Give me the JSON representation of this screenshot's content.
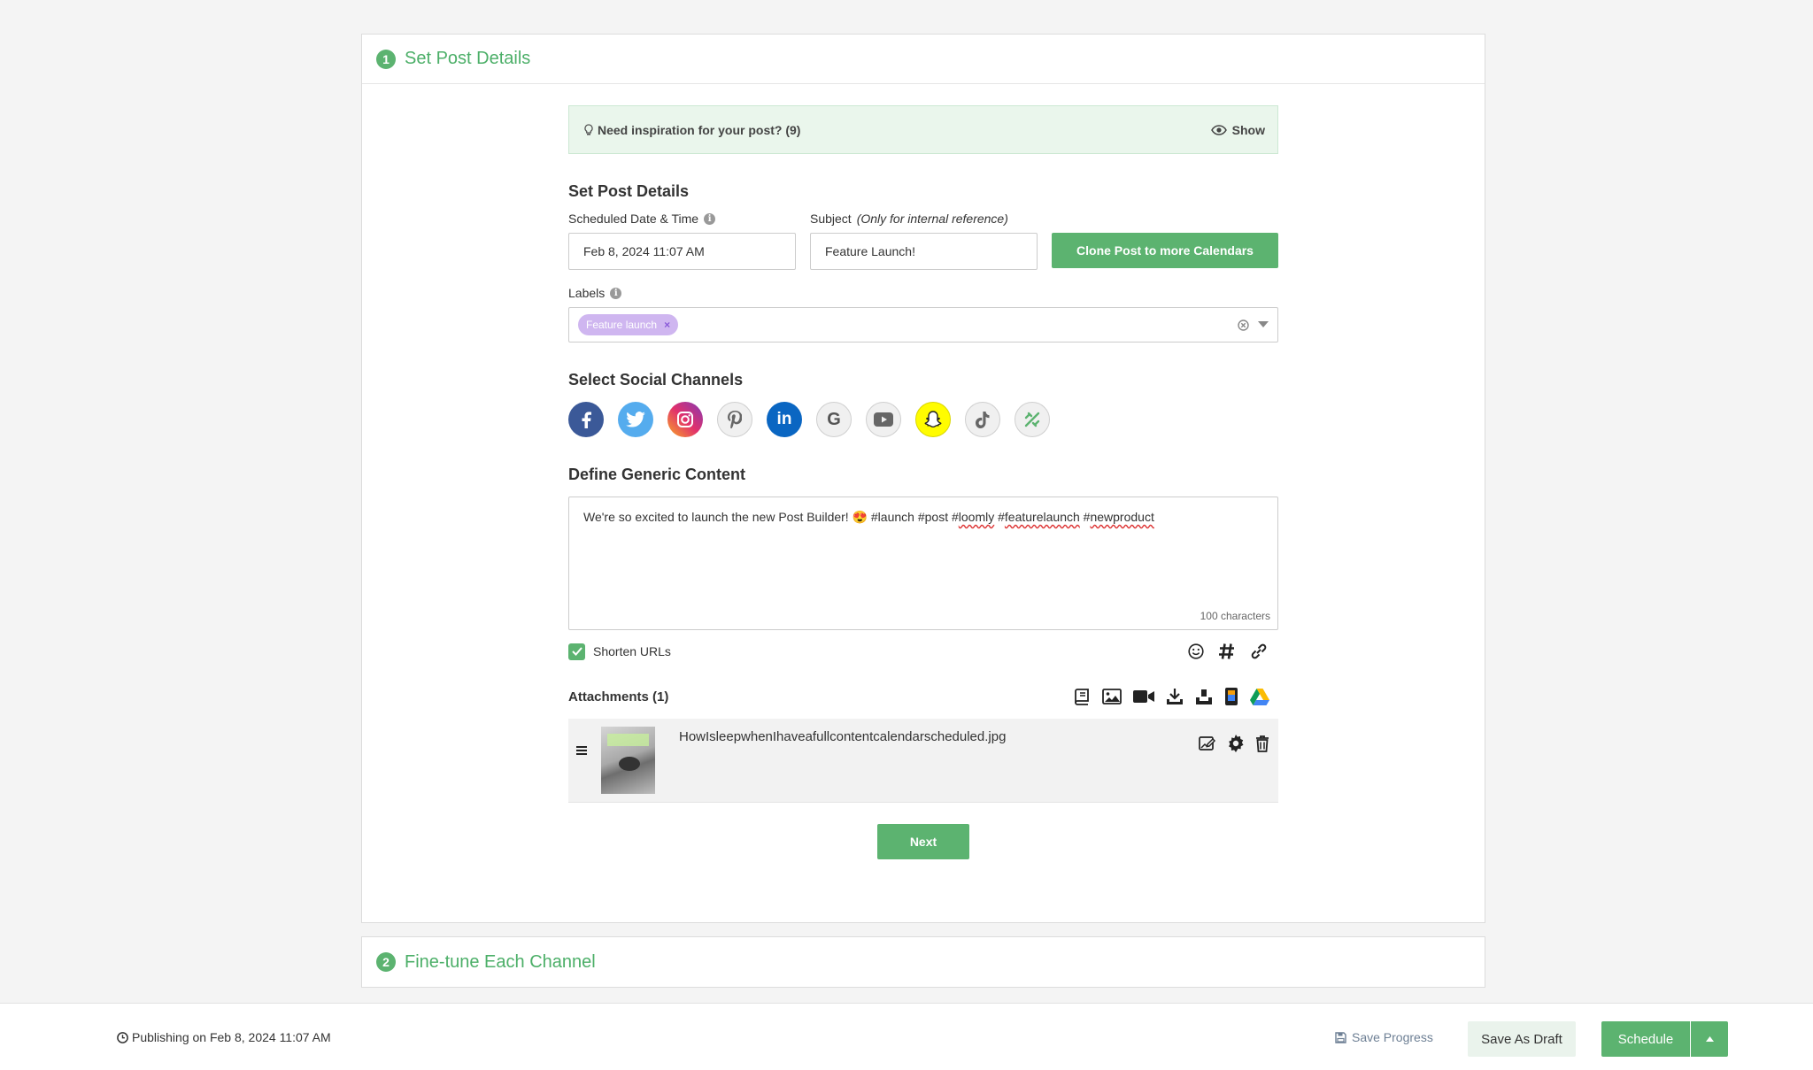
{
  "steps": [
    {
      "number": "1",
      "title": "Set Post Details"
    },
    {
      "number": "2",
      "title": "Fine-tune Each Channel"
    }
  ],
  "inspiration": {
    "text": "Need inspiration for your post? (9)",
    "action": "Show"
  },
  "post_details": {
    "title": "Set Post Details",
    "date_label": "Scheduled Date & Time",
    "date_value": "Feb 8, 2024 11:07 AM",
    "subject_label": "Subject",
    "subject_hint": "(Only for internal reference)",
    "subject_value": "Feature Launch!",
    "clone_button": "Clone Post to more Calendars",
    "labels_label": "Labels",
    "tags": [
      "Feature launch"
    ]
  },
  "channels": {
    "title": "Select Social Channels",
    "items": [
      {
        "name": "facebook",
        "color": "#3b5998"
      },
      {
        "name": "twitter",
        "color": "#55acee"
      },
      {
        "name": "instagram",
        "color": "#d6249f"
      },
      {
        "name": "pinterest",
        "color": "#f0f0f0"
      },
      {
        "name": "linkedin",
        "color": "#0a66c2"
      },
      {
        "name": "google",
        "color": "#f0f0f0"
      },
      {
        "name": "youtube",
        "color": "#f0f0f0"
      },
      {
        "name": "snapchat",
        "color": "#fffc00"
      },
      {
        "name": "tiktok",
        "color": "#f0f0f0"
      },
      {
        "name": "custom",
        "color": "#f0f0f0"
      }
    ]
  },
  "content": {
    "title": "Define Generic Content",
    "text_plain": "We're so excited to launch the new Post Builder! 😍 #launch #post #",
    "text_u1": "loomly",
    "text_mid": " #",
    "text_u2": "featurelaunch",
    "text_mid2": " #",
    "text_u3": "newproduct",
    "char_count": "100 characters",
    "shorten_urls": "Shorten URLs"
  },
  "attachments": {
    "title": "Attachments (1)",
    "items": [
      {
        "filename": "HowIsleepwhenIhaveafullcontentcalendarscheduled.jpg"
      }
    ]
  },
  "next_button": "Next",
  "footer": {
    "publishing": "Publishing on Feb 8, 2024 11:07 AM",
    "save_progress": "Save Progress",
    "save_draft": "Save As Draft",
    "schedule": "Schedule"
  },
  "colors": {
    "accent": "#5cb370",
    "label_tag": "#cfb6f0"
  }
}
